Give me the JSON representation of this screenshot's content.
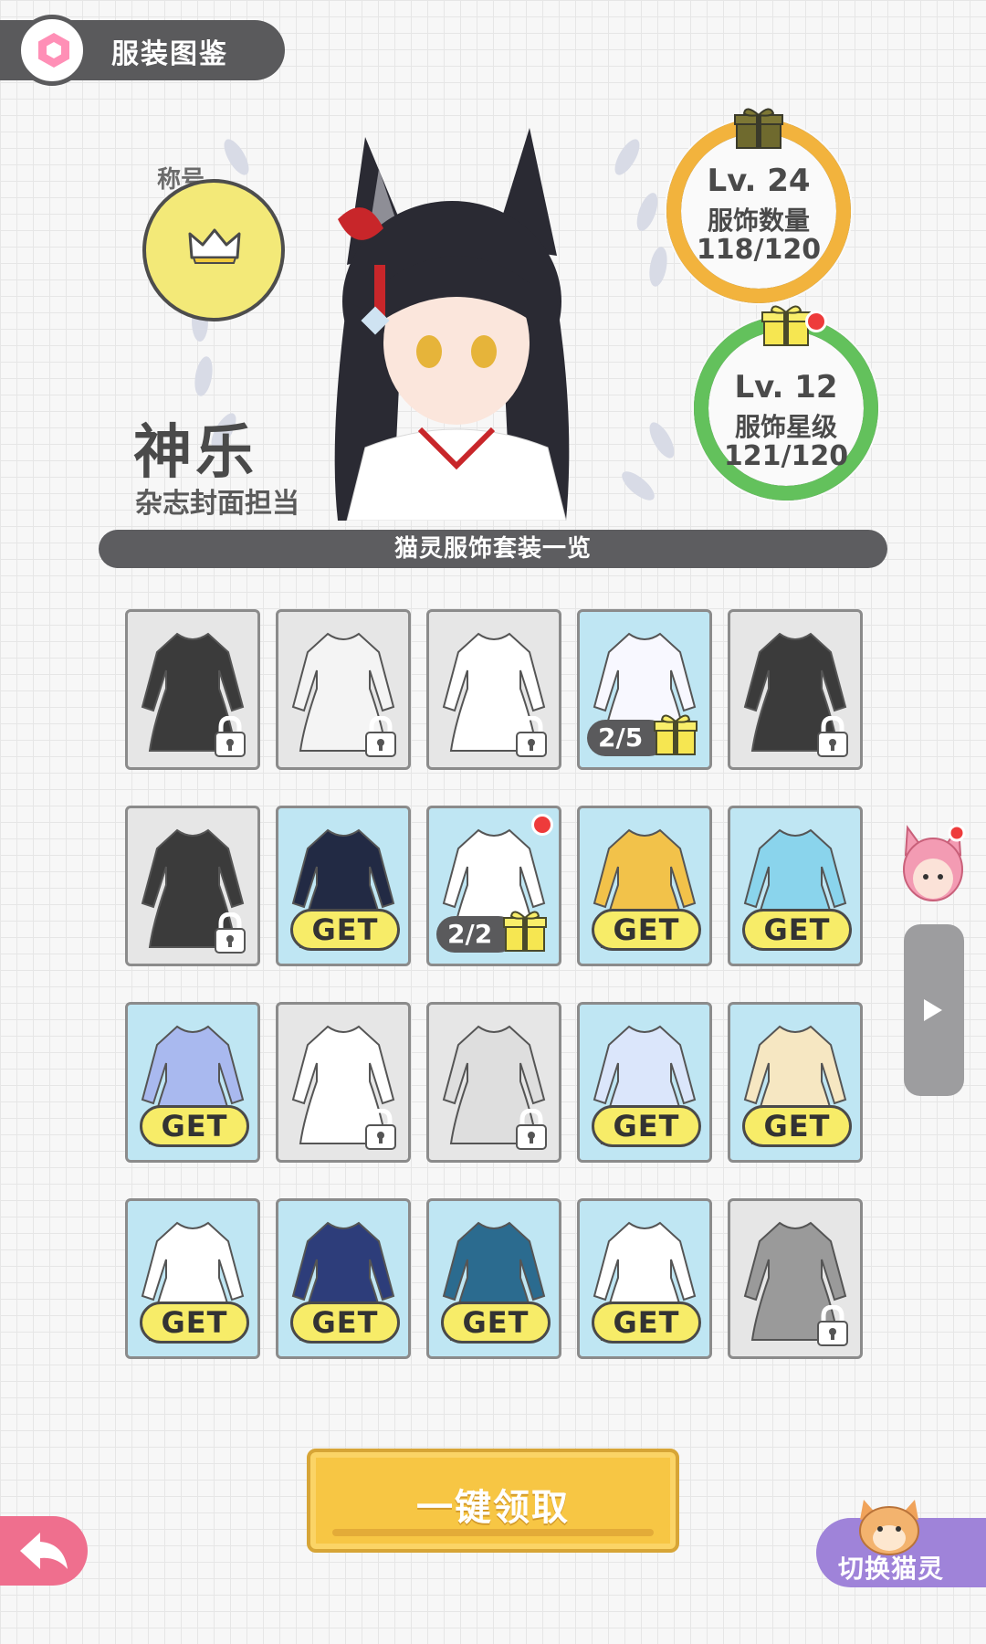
{
  "header": {
    "title": "服装图鉴"
  },
  "profile": {
    "title_label": "称号",
    "title_icon": "crown-icon",
    "name": "神乐",
    "role": "杂志封面担当"
  },
  "stats": {
    "count": {
      "level": "Lv. 24",
      "label": "服饰数量",
      "value": "118/120",
      "progress": 0.983,
      "color": "#f2b33d"
    },
    "stars": {
      "level": "Lv. 12",
      "label": "服饰星级",
      "value": "121/120",
      "progress": 1.0,
      "color": "#63c15c",
      "has_notification": true
    }
  },
  "section": {
    "title": "猫灵服饰套装一览"
  },
  "outfits": [
    {
      "state": "locked"
    },
    {
      "state": "locked"
    },
    {
      "state": "locked"
    },
    {
      "state": "progress",
      "progress": "2/5"
    },
    {
      "state": "locked"
    },
    {
      "state": "locked"
    },
    {
      "state": "get",
      "label": "GET"
    },
    {
      "state": "progress",
      "progress": "2/2",
      "has_notification": true
    },
    {
      "state": "get",
      "label": "GET"
    },
    {
      "state": "get",
      "label": "GET"
    },
    {
      "state": "get",
      "label": "GET"
    },
    {
      "state": "locked"
    },
    {
      "state": "locked"
    },
    {
      "state": "get",
      "label": "GET"
    },
    {
      "state": "get",
      "label": "GET"
    },
    {
      "state": "get",
      "label": "GET"
    },
    {
      "state": "get",
      "label": "GET"
    },
    {
      "state": "get",
      "label": "GET"
    },
    {
      "state": "get",
      "label": "GET"
    },
    {
      "state": "locked"
    }
  ],
  "footer": {
    "claim_all": "一键领取",
    "switch_spirit": "切换猫灵"
  },
  "colors": {
    "accent_yellow": "#f7c644",
    "get_badge": "#f7ec68",
    "owned_bg": "#bfe6f3",
    "locked_bg": "#e6e6e6"
  }
}
